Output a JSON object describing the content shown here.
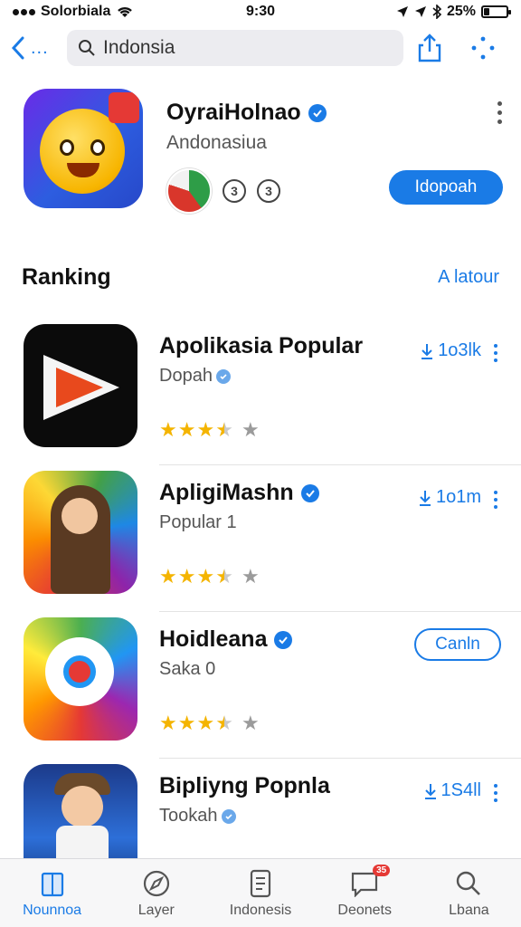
{
  "status_bar": {
    "carrier": "Solorbiala",
    "time": "9:30",
    "battery_text": "25%",
    "battery_level": 0.25
  },
  "search": {
    "value": "Indonsia"
  },
  "header_app": {
    "name": "OyraiHolnao",
    "subtitle": "Andonasiua",
    "get_label": "Idopoah",
    "chip_a": "3",
    "chip_b": "3"
  },
  "ranking": {
    "title": "Ranking",
    "link_label": "A latour"
  },
  "rank_items": [
    {
      "title": "Apolikasia Popular",
      "subtitle": "Dopah",
      "action": "1o3lk",
      "rating": 3.5,
      "verified": false
    },
    {
      "title": "ApligiMashn",
      "subtitle": "Popular 1",
      "action": "1o1m",
      "rating": 3.5,
      "verified": true
    },
    {
      "title": "Hoidleana",
      "subtitle": "Saka 0",
      "action": "Canln",
      "rating": 3.5,
      "verified": true
    },
    {
      "title": "Bipliyng Popnla",
      "subtitle": "Tookah",
      "action": "1S4ll",
      "rating": 3.5,
      "verified": false
    }
  ],
  "tabs": [
    {
      "label": "Nounnoa",
      "icon": "book-icon",
      "active": true
    },
    {
      "label": "Layer",
      "icon": "compass-icon",
      "active": false,
      "badge": ""
    },
    {
      "label": "Indonesis",
      "icon": "document-icon",
      "active": false
    },
    {
      "label": "Deonets",
      "icon": "message-icon",
      "active": false,
      "badge": "35"
    },
    {
      "label": "Lbana",
      "icon": "search-icon",
      "active": false
    }
  ],
  "colors": {
    "accent": "#1a7be6",
    "star": "#f4b400"
  }
}
